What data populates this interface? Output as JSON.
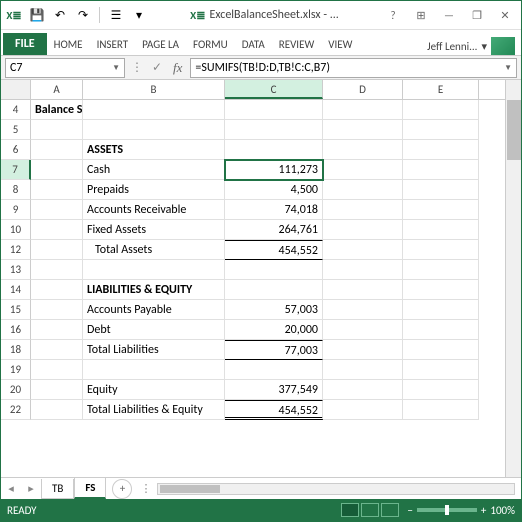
{
  "title": {
    "filename": "ExcelBalanceSheet.xlsx - ..."
  },
  "ribbon": {
    "file": "FILE",
    "tabs": [
      "HOME",
      "INSERT",
      "PAGE LA",
      "FORMU",
      "DATA",
      "REVIEW",
      "VIEW"
    ],
    "user": "Jeff Lenni..."
  },
  "namebox": "C7",
  "formula": "=SUMIFS(TB!D:D,TB!C:C,B7)",
  "columns": [
    "A",
    "B",
    "C",
    "D",
    "E"
  ],
  "rows": [
    {
      "n": "4",
      "A": "Balance Sheet",
      "bold": true,
      "sel": false
    },
    {
      "n": "5"
    },
    {
      "n": "6",
      "B": "ASSETS",
      "bold": true
    },
    {
      "n": "7",
      "B": "Cash",
      "C": "111,273",
      "sel": true
    },
    {
      "n": "8",
      "B": "Prepaids",
      "C": "4,500"
    },
    {
      "n": "9",
      "B": "Accounts Receivable",
      "C": "74,018"
    },
    {
      "n": "10",
      "B": "Fixed Assets",
      "C": "264,761"
    },
    {
      "n": "12",
      "B": " Total Assets",
      "C": "454,552",
      "totals": "single",
      "indent": true
    },
    {
      "n": "13"
    },
    {
      "n": "14",
      "B": "LIABILITIES & EQUITY",
      "bold": true
    },
    {
      "n": "15",
      "B": "Accounts Payable",
      "C": "57,003"
    },
    {
      "n": "16",
      "B": "Debt",
      "C": "20,000"
    },
    {
      "n": "18",
      "B": "Total Liabilities",
      "C": "77,003",
      "totals": "single"
    },
    {
      "n": "19"
    },
    {
      "n": "20",
      "B": "Equity",
      "C": "377,549"
    },
    {
      "n": "22",
      "B": "Total Liabilities & Equity",
      "C": "454,552",
      "totals": "double"
    }
  ],
  "sheets": {
    "tabs": [
      "TB",
      "FS"
    ],
    "active": "FS"
  },
  "status": {
    "ready": "READY",
    "zoom": "100%"
  },
  "qat": {
    "save": "💾",
    "undo": "↶",
    "redo": "↷"
  }
}
